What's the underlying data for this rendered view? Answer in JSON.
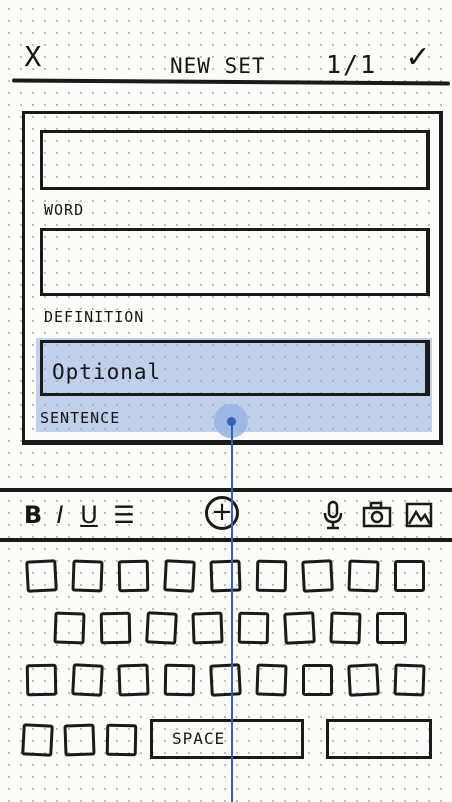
{
  "header": {
    "close_label": "X",
    "title": "NEW SET",
    "counter": "1/1",
    "done_label": "✓"
  },
  "card": {
    "word_label": "WORD",
    "definition_label": "DEFINITION",
    "sentence_label": "SENTENCE",
    "sentence_value": "Optional",
    "highlight_color": "#8facde"
  },
  "toolbar": {
    "bold": "B",
    "italic": "I",
    "underline": "U",
    "list": "☰",
    "add": "+",
    "mic": "🎙",
    "camera": "📷",
    "image": "🖼"
  },
  "keyboard": {
    "row_counts": [
      9,
      8,
      9,
      3
    ],
    "space_label": "SPACE"
  },
  "colors": {
    "ink": "#161616",
    "tap_indicator": "#2f62b8"
  }
}
